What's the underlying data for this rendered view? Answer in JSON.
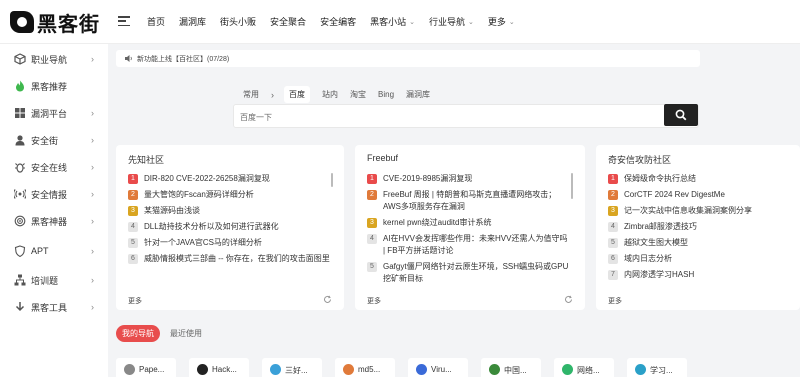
{
  "logo": {
    "text": "黑客街"
  },
  "topnav": [
    {
      "label": "首页",
      "caret": false
    },
    {
      "label": "漏洞库",
      "caret": false
    },
    {
      "label": "街头小贩",
      "caret": false
    },
    {
      "label": "安全聚合",
      "caret": false
    },
    {
      "label": "安全编客",
      "caret": false
    },
    {
      "label": "黑客小站",
      "caret": true
    },
    {
      "label": "行业导航",
      "caret": true
    },
    {
      "label": "更多",
      "caret": true
    }
  ],
  "sidebar": [
    {
      "label": "职业导航",
      "icon": "cube-icon",
      "arrow": true
    },
    {
      "label": "黑客推荐",
      "icon": "flame-icon",
      "arrow": false
    },
    {
      "label": "漏洞平台",
      "icon": "windows-icon",
      "arrow": true
    },
    {
      "label": "安全街",
      "icon": "user-icon",
      "arrow": true
    },
    {
      "label": "安全在线",
      "icon": "bug-icon",
      "arrow": true
    },
    {
      "label": "安全情报",
      "icon": "radar-icon",
      "arrow": true
    },
    {
      "label": "黑客神器",
      "icon": "target-icon",
      "arrow": true
    },
    {
      "label": "APT",
      "icon": "shield-icon",
      "arrow": true
    },
    {
      "label": "培训题",
      "icon": "hierarchy-icon",
      "arrow": true
    },
    {
      "label": "黑客工具",
      "icon": "download-icon",
      "arrow": true
    }
  ],
  "notice": {
    "text": "新功能上线【百社区】(07/28)",
    "icon": "speaker-icon"
  },
  "search": {
    "tabs": [
      "常用",
      "百度",
      "站内",
      "淘宝",
      "Bing",
      "漏洞库"
    ],
    "active_tab": "百度",
    "placeholder": "百度一下",
    "button_icon": "search-icon"
  },
  "cards": [
    {
      "title": "先知社区",
      "items": [
        {
          "n": "1",
          "text": "DIR-820 CVE-2022-26258漏洞复现"
        },
        {
          "n": "2",
          "text": "量大管饱的Fscan源码详细分析"
        },
        {
          "n": "3",
          "text": "某猫源码由浅谈"
        },
        {
          "n": "4",
          "text": "DLL劫持技术分析以及如何进行武器化"
        },
        {
          "n": "5",
          "text": "针对一个JAVA官CS马的详细分析"
        },
        {
          "n": "6",
          "text": "威胁情报模式三部曲 -- 你存在，在我们的攻击面图里"
        }
      ],
      "more": "更多"
    },
    {
      "title": "Freebuf",
      "items": [
        {
          "n": "1",
          "text": "CVE-2019-8985漏洞复现"
        },
        {
          "n": "2",
          "text": "FreeBuf 周报 | 特朗普和马斯克直播遭网络攻击；AWS多项服务存在漏洞"
        },
        {
          "n": "3",
          "text": "kernel pwn绕过auditd审计系统"
        },
        {
          "n": "4",
          "text": "AI在HVV会发挥哪些作用：未来HVV还需人为值守吗 | FB平方拼话题讨论"
        },
        {
          "n": "5",
          "text": "Gafgyt僵尸网络针对云原生环境，SSH蠕虫码或GPU挖矿新目标"
        }
      ],
      "more": "更多"
    },
    {
      "title": "奇安信攻防社区",
      "items": [
        {
          "n": "1",
          "text": "保姆级命令执行总结"
        },
        {
          "n": "2",
          "text": "CorCTF 2024 Rev DigestMe"
        },
        {
          "n": "3",
          "text": "记一次实战中信息收集漏洞案例分享"
        },
        {
          "n": "4",
          "text": "Zimbra邮服渗透技巧"
        },
        {
          "n": "5",
          "text": "越狱文生图大模型"
        },
        {
          "n": "6",
          "text": "域内日志分析"
        },
        {
          "n": "7",
          "text": "内网渗透学习HASH"
        }
      ],
      "more": "更多"
    }
  ],
  "bottom_tabs": [
    "我的导航",
    "最近使用"
  ],
  "bottom_active": "我的导航",
  "tiles": [
    {
      "label": "Pape...",
      "icon": "paper-icon",
      "color": "#888888"
    },
    {
      "label": "Hack...",
      "icon": "hack-icon",
      "color": "#222222"
    },
    {
      "label": "三好...",
      "icon": "sanhao-icon",
      "color": "#3aa0d8"
    },
    {
      "label": "md5...",
      "icon": "md5-icon",
      "color": "#e07a3a"
    },
    {
      "label": "Viru...",
      "icon": "virus-icon",
      "color": "#3a6ad8"
    },
    {
      "label": "中国...",
      "icon": "china-icon",
      "color": "#3a8a3a"
    },
    {
      "label": "网络...",
      "icon": "net-icon",
      "color": "#2fb56a"
    },
    {
      "label": "学习...",
      "icon": "learn-icon",
      "color": "#2aa0c8"
    }
  ],
  "colors": {
    "accent": "#e84d4d",
    "rank1": "#e94b4b",
    "rank2": "#e07a3a",
    "rank3": "#d9a521",
    "dark_button": "#222222"
  }
}
